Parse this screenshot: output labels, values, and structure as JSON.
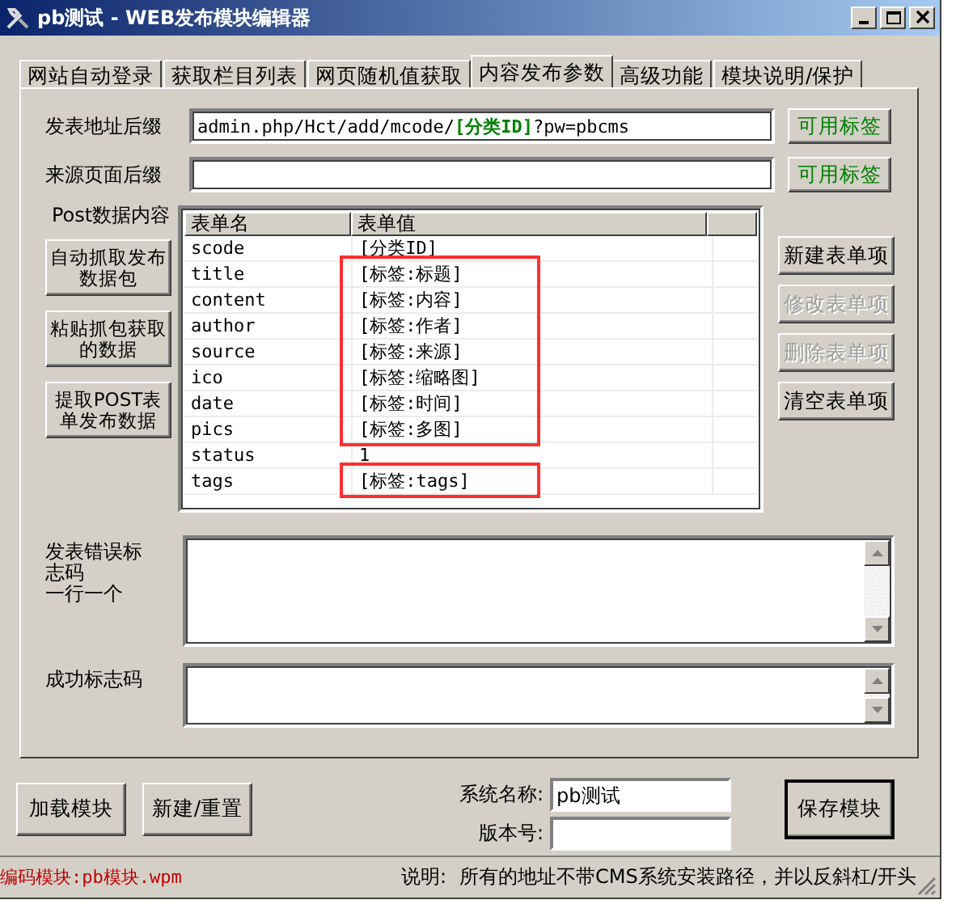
{
  "window": {
    "title": "pb测试 - WEB发布模块编辑器"
  },
  "tabs": [
    {
      "label": "网站自动登录",
      "selected": false
    },
    {
      "label": "获取栏目列表",
      "selected": false
    },
    {
      "label": "网页随机值获取",
      "selected": false
    },
    {
      "label": "内容发布参数",
      "selected": true
    },
    {
      "label": "高级功能",
      "selected": false
    },
    {
      "label": "模块说明/保护",
      "selected": false
    }
  ],
  "url_fields": [
    {
      "label": "发表地址后缀",
      "value": "admin.php/Hct/add/mcode/**[分类ID]**?pw=pbcms",
      "button": "可用标签"
    },
    {
      "label": "来源页面后缀",
      "button": "可用标签"
    }
  ],
  "post_data": {
    "label": "Post数据内容",
    "buttons": [
      "自动抓取发布数据包",
      "粘贴抓包获取的数据",
      "提取POST表单发布数据"
    ],
    "columns": [
      "表单名",
      "表单值"
    ],
    "rows": [
      {
        "name": "scode",
        "value": "[分类ID]",
        "boxed": false
      },
      {
        "name": "title",
        "value": "[标签:标题]",
        "boxed": true
      },
      {
        "name": "content",
        "value": "[标签:内容]",
        "boxed": true
      },
      {
        "name": "author",
        "value": "[标签:作者]",
        "boxed": true
      },
      {
        "name": "source",
        "value": "[标签:来源]",
        "boxed": true
      },
      {
        "name": "ico",
        "value": "[标签:缩略图]",
        "boxed": true
      },
      {
        "name": "date",
        "value": "[标签:时间]",
        "boxed": true
      },
      {
        "name": "pics",
        "value": "[标签:多图]",
        "boxed": true
      },
      {
        "name": "status",
        "value": "1",
        "boxed": false
      },
      {
        "name": "tags",
        "value": "[标签:tags]",
        "boxed": true
      }
    ],
    "actions": [
      {
        "label": "新建表单项",
        "disabled": false
      },
      {
        "label": "修改表单项",
        "disabled": true
      },
      {
        "label": "删除表单项",
        "disabled": true
      },
      {
        "label": "清空表单项",
        "disabled": false
      }
    ]
  },
  "error_codes": {
    "label": "发表错误标志码",
    "hint": "一行一个"
  },
  "success_codes": {
    "label": "成功标志码"
  },
  "bottom": {
    "buttons": [
      "加载模块",
      "新建/重置"
    ],
    "system_name": {
      "label": "系统名称:",
      "value": "pb测试"
    },
    "version": {
      "label": "版本号:"
    },
    "save_button": "保存模块"
  },
  "status_bar": {
    "module": "编码模块:pb模块.wpm",
    "note_label": "说明:",
    "note": "所有的地址不带CMS系统安装路径，并以反斜杠/开头"
  }
}
